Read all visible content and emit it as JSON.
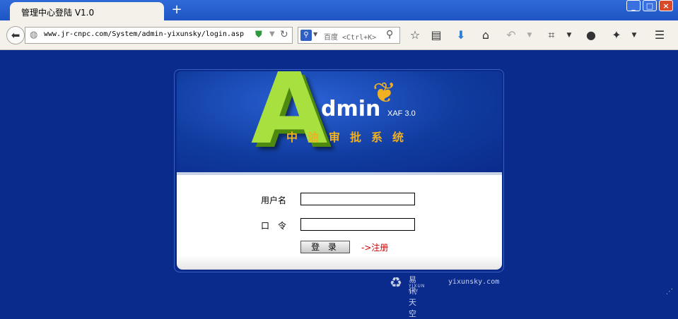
{
  "browser": {
    "tab_title": "管理中心登陆 V1.0",
    "new_tab": "+",
    "url": "www.jr-cnpc.com/System/admin-yixunsky/login.asp",
    "search_engine": "百度",
    "search_placeholder": "百度 <Ctrl+K>",
    "window_controls": {
      "minimize": "_",
      "maximize": "□",
      "close": "×"
    },
    "icons": [
      "back-icon",
      "globe-icon",
      "shield-icon",
      "reload-icon",
      "search-icon",
      "star-icon",
      "reading-list-icon",
      "download-icon",
      "home-icon",
      "undo-icon",
      "crop-icon",
      "chat-icon",
      "puzzle-icon",
      "menu-icon"
    ]
  },
  "banner": {
    "logo_letter": "A",
    "logo_word": "dmin",
    "version": "XAF 3.0",
    "system_name": "中油审批系统"
  },
  "form": {
    "username_label": "用户名",
    "password_label": "口　令",
    "username_value": "",
    "password_value": "",
    "login_button": "登 录",
    "register_link": "->注册"
  },
  "footer": {
    "brand_cn": "易讯天空",
    "brand_en": "YIXUN SKY",
    "domain": "yixunsky.com"
  },
  "colors": {
    "page_background": "#0a2a8c",
    "logo_green": "#a8e040",
    "title_gold": "#f0b020",
    "register_red": "#cc0000"
  }
}
